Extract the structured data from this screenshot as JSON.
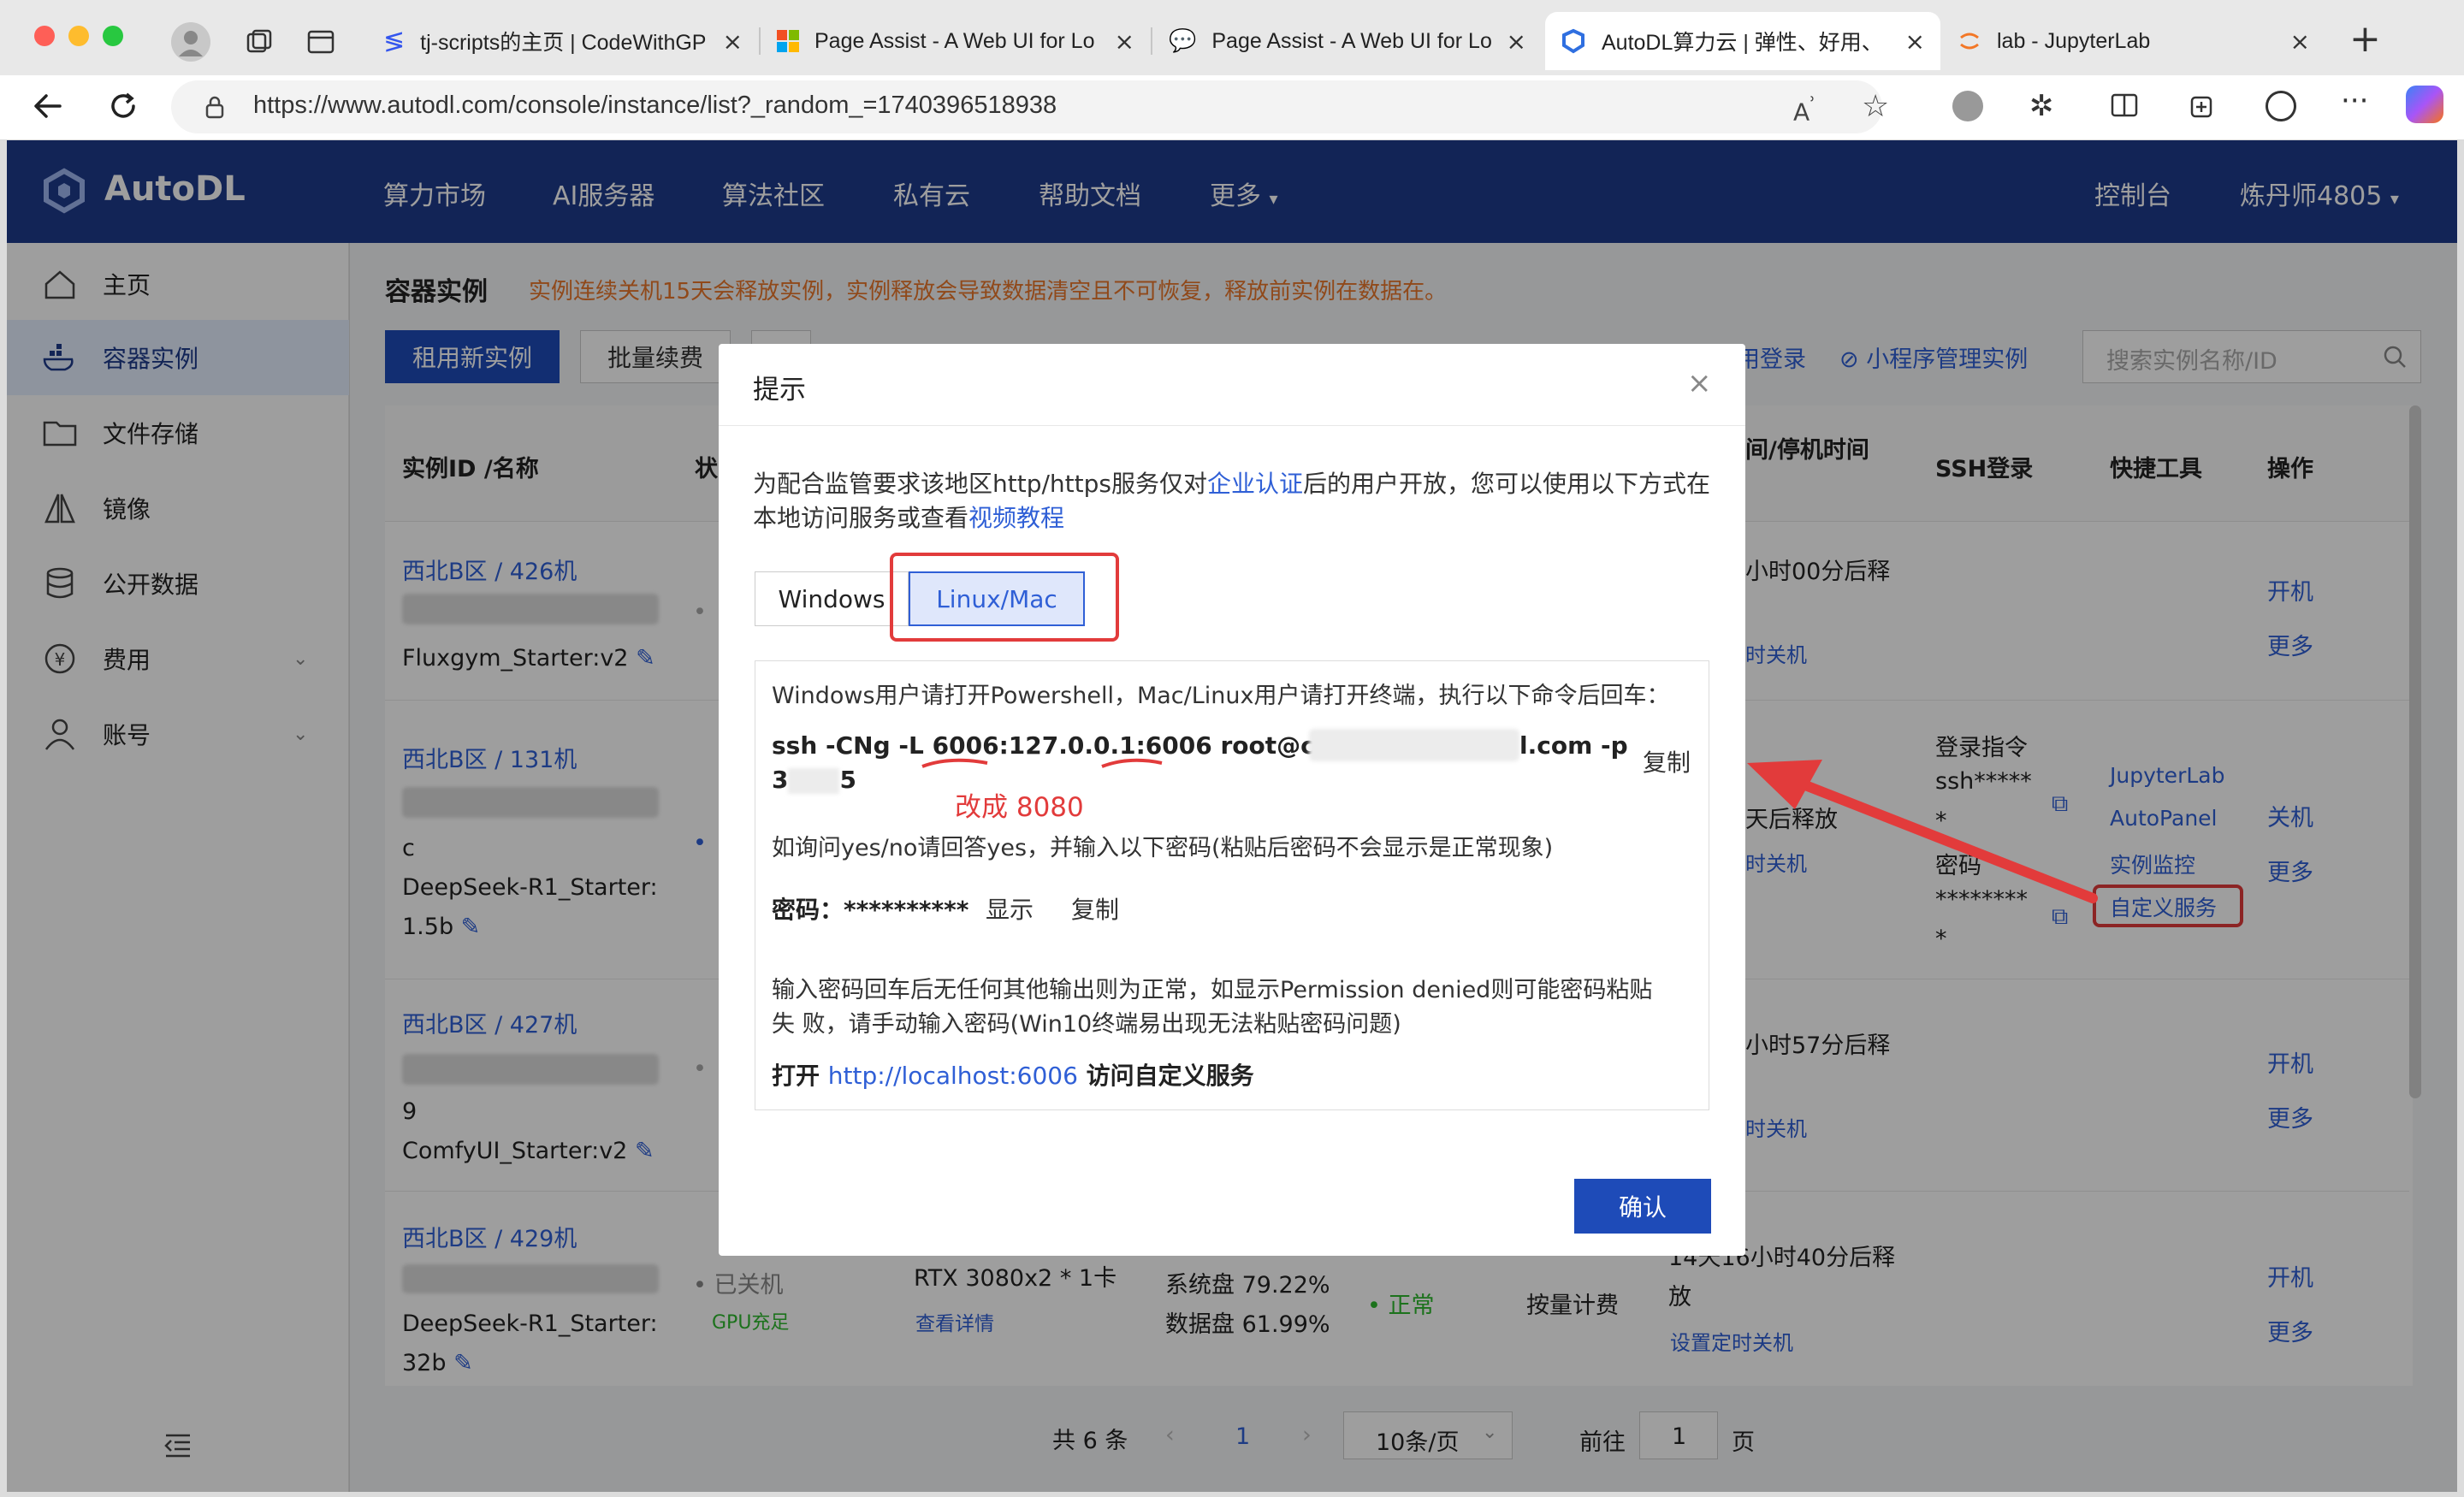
{
  "browser": {
    "tabs": [
      {
        "label": "tj-scripts的主页 | CodeWithGP"
      },
      {
        "label": "Page Assist - A Web UI for Lo"
      },
      {
        "label": "Page Assist - A Web UI for Lo"
      },
      {
        "label": "AutoDL算力云 | 弹性、好用、"
      },
      {
        "label": "lab - JupyterLab"
      }
    ],
    "new_tab": "+",
    "url": "https://www.autodl.com/console/instance/list?_random_=1740396518938"
  },
  "header": {
    "logo": "AutoDL",
    "nav": [
      "算力市场",
      "AI服务器",
      "算法社区",
      "私有云",
      "帮助文档",
      "更多"
    ],
    "console": "控制台",
    "user": "炼丹师4805"
  },
  "sidebar": {
    "items": [
      {
        "label": "主页"
      },
      {
        "label": "容器实例"
      },
      {
        "label": "文件存储"
      },
      {
        "label": "镜像"
      },
      {
        "label": "公开数据"
      },
      {
        "label": "费用"
      },
      {
        "label": "账号"
      }
    ]
  },
  "main": {
    "title": "容器实例",
    "warning": "实例连续关机15天会释放实例，实例释放会导致数据清空且不可恢复，释放前实例在数据在。",
    "new_button": "租用新实例",
    "batch_button": "批量续费",
    "login_link": "用登录",
    "mini_program": "小程序管理实例",
    "search_placeholder": "搜索实例名称/ID",
    "columns": {
      "id": "实例ID /名称",
      "status": "状",
      "time": "间/停机时间",
      "ssh": "SSH登录",
      "tools": "快捷工具",
      "ops": "操作"
    },
    "rows": [
      {
        "region": "西北B区 / 426机",
        "name": "Fluxgym_Starter:v2",
        "time": "小时00分后释",
        "shutdown": "时关机",
        "op1": "开机",
        "op2": "更多"
      },
      {
        "region": "西北B区 / 131机",
        "name1": "c",
        "name2": "DeepSeek-R1_Starter:",
        "name3": "1.5b",
        "time": "天后释放",
        "shutdown": "时关机",
        "ssh1": "登录指令",
        "ssh2": "ssh*****",
        "ssh3": "*",
        "ssh4": "密码",
        "ssh5": "********",
        "ssh6": "*",
        "tool1": "JupyterLab",
        "tool2": "AutoPanel",
        "tool3": "实例监控",
        "tool4": "自定义服务",
        "op1": "关机",
        "op2": "更多"
      },
      {
        "region": "西北B区 / 427机",
        "name1": "9",
        "name2": "ComfyUI_Starter:v2",
        "time": "小时57分后释",
        "shutdown": "时关机",
        "op1": "开机",
        "op2": "更多"
      },
      {
        "region": "西北B区 / 429机",
        "status": "已关机",
        "gpu_status": "GPU充足",
        "gpu": "RTX 3080x2 * 1卡",
        "detail": "查看详情",
        "disk1": "系统盘 79.22%",
        "disk2": "数据盘 61.99%",
        "health": "正常",
        "billing": "按量计费",
        "time1": "14天16小时40分后释",
        "time2": "放",
        "shutdown": "设置定时关机",
        "name2": "DeepSeek-R1_Starter:",
        "name3": "32b",
        "op1": "开机",
        "op2": "更多"
      }
    ],
    "pagination": {
      "total": "共 6 条",
      "page": "1",
      "per_page": "10条/页",
      "goto": "前往",
      "goto_value": "1",
      "suffix": "页"
    }
  },
  "modal": {
    "title": "提示",
    "close": "×",
    "intro_1": "为配合监管要求该地区http/https服务仅对",
    "intro_link": "企业认证",
    "intro_2": "后的用户开放，您可以使用以下方式在",
    "intro_3": "本地访问服务或查看",
    "intro_video": "视频教程",
    "tab_windows": "Windows",
    "tab_linux": "Linux/Mac",
    "instruction": "Windows用户请打开Powershell，Mac/Linux用户请打开终端，执行以下命令后回车：",
    "cmd_pre": "ssh -CNg -L ",
    "cmd_port1": "6006",
    "cmd_mid": ":127.0.0.1:",
    "cmd_port2": "6006",
    "cmd_post": " root@connec",
    "cmd_end": "l.com -p",
    "cmd_line2a": "3",
    "cmd_line2b": "5",
    "copy": "复制",
    "annotation": "改成 8080",
    "yes_no": "如询问yes/no请回答yes，并输入以下密码(粘贴后密码不会显示是正常现象)",
    "pwd_label": "密码：",
    "pwd_value": "**********",
    "show": "显示",
    "copy2": "复制",
    "note": "输入密码回车后无任何其他输出则为正常，如显示Permission denied则可能密码粘贴",
    "note2": "失 败，请手动输入密码(Win10终端易出现无法粘贴密码问题)",
    "open_pre": "打开 ",
    "open_link": "http://localhost:6006",
    "open_post": " 访问自定义服务",
    "confirm": "确认"
  },
  "colors": {
    "brand": "#1e3a8c",
    "link": "#2f5fd6",
    "warning": "#e8762a",
    "annotation": "#e23b3b",
    "success": "#2eb82e"
  }
}
